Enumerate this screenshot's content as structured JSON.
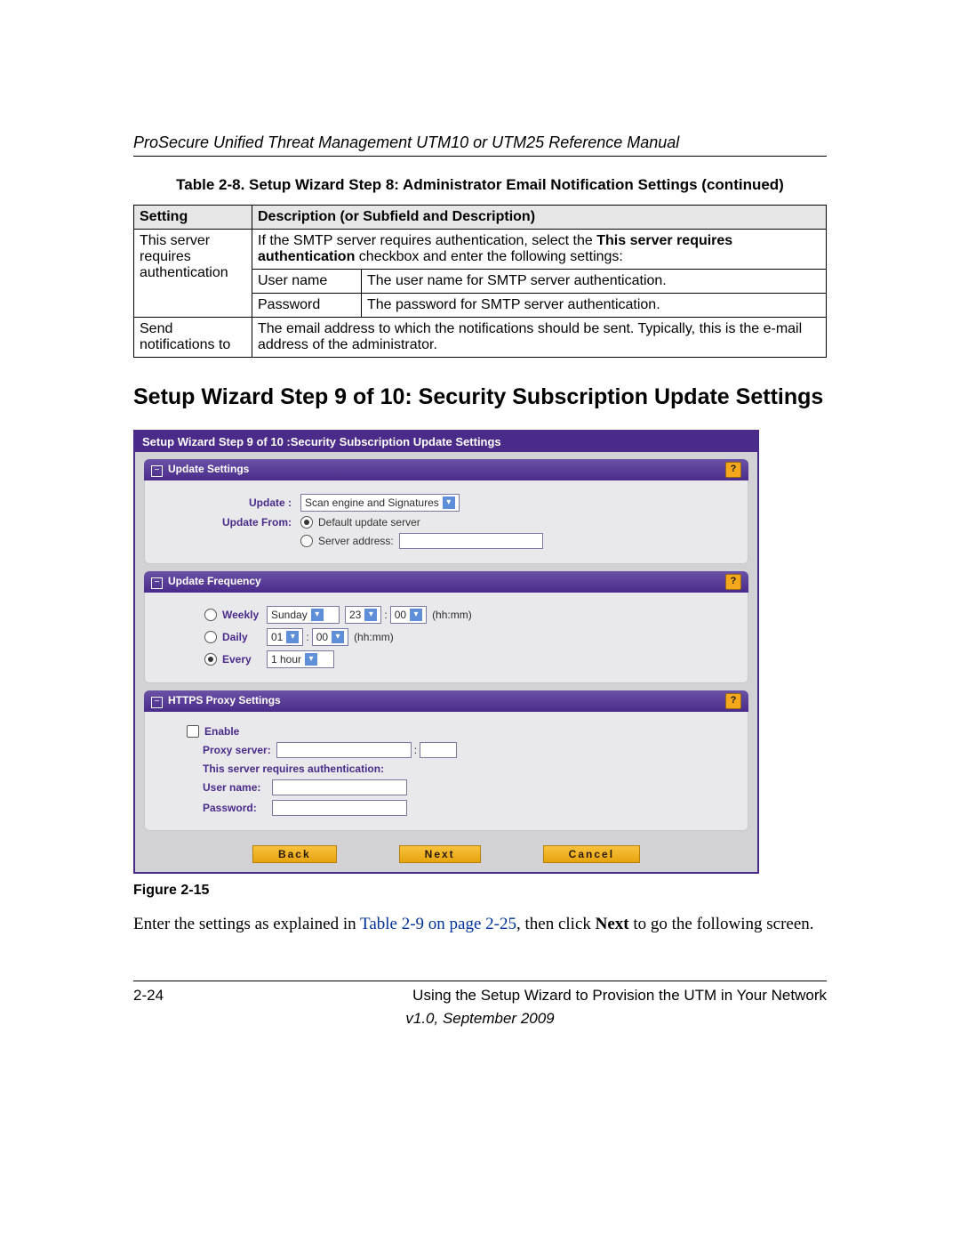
{
  "doc_header": "ProSecure Unified Threat Management UTM10 or UTM25 Reference Manual",
  "table_caption": "Table 2-8.   Setup Wizard Step 8: Administrator Email Notification Settings (continued)",
  "table": {
    "head_setting": "Setting",
    "head_desc": "Description (or Subfield and Description)",
    "row1_setting": "This server requires authentication",
    "row1_desc_pre": "If the SMTP server requires authentication, select the ",
    "row1_desc_bold": "This server requires authentication",
    "row1_desc_post": " checkbox and enter the following settings:",
    "row1a_sub": "User name",
    "row1a_desc": "The user name for SMTP server authentication.",
    "row1b_sub": "Password",
    "row1b_desc": "The password for SMTP server authentication.",
    "row2_setting": "Send notifications to",
    "row2_desc": "The email address to which the notifications should be sent. Typically, this is the e-mail address of the administrator."
  },
  "section_heading": "Setup Wizard Step 9 of 10: Security Subscription Update Settings",
  "shot": {
    "title": "Setup Wizard Step 9 of 10 :Security Subscription Update Settings",
    "panel1": {
      "title": "Update Settings",
      "update_label": "Update :",
      "update_value": "Scan engine and Signatures",
      "update_from_label": "Update From:",
      "opt_default": "Default update server",
      "opt_server_addr": "Server address:"
    },
    "panel2": {
      "title": "Update Frequency",
      "weekly": "Weekly",
      "weekly_day": "Sunday",
      "weekly_hh": "23",
      "weekly_mm": "00",
      "hhmm": "(hh:mm)",
      "daily": "Daily",
      "daily_hh": "01",
      "daily_mm": "00",
      "every": "Every",
      "every_val": "1 hour"
    },
    "panel3": {
      "title": "HTTPS Proxy Settings",
      "enable": "Enable",
      "proxy_server": "Proxy server:",
      "auth_req": "This server requires authentication:",
      "user_name": "User name:",
      "password": "Password:"
    },
    "buttons": {
      "back": "Back",
      "next": "Next",
      "cancel": "Cancel"
    },
    "help": "?"
  },
  "figure_caption": "Figure 2-15",
  "body_para": {
    "pre": "Enter the settings as explained in ",
    "link": "Table 2-9 on page 2-25",
    "mid": ", then click ",
    "bold": "Next",
    "post": " to go the following screen."
  },
  "footer": {
    "page_num": "2-24",
    "chapter": "Using the Setup Wizard to Provision the UTM in Your Network",
    "version": "v1.0, September 2009"
  }
}
